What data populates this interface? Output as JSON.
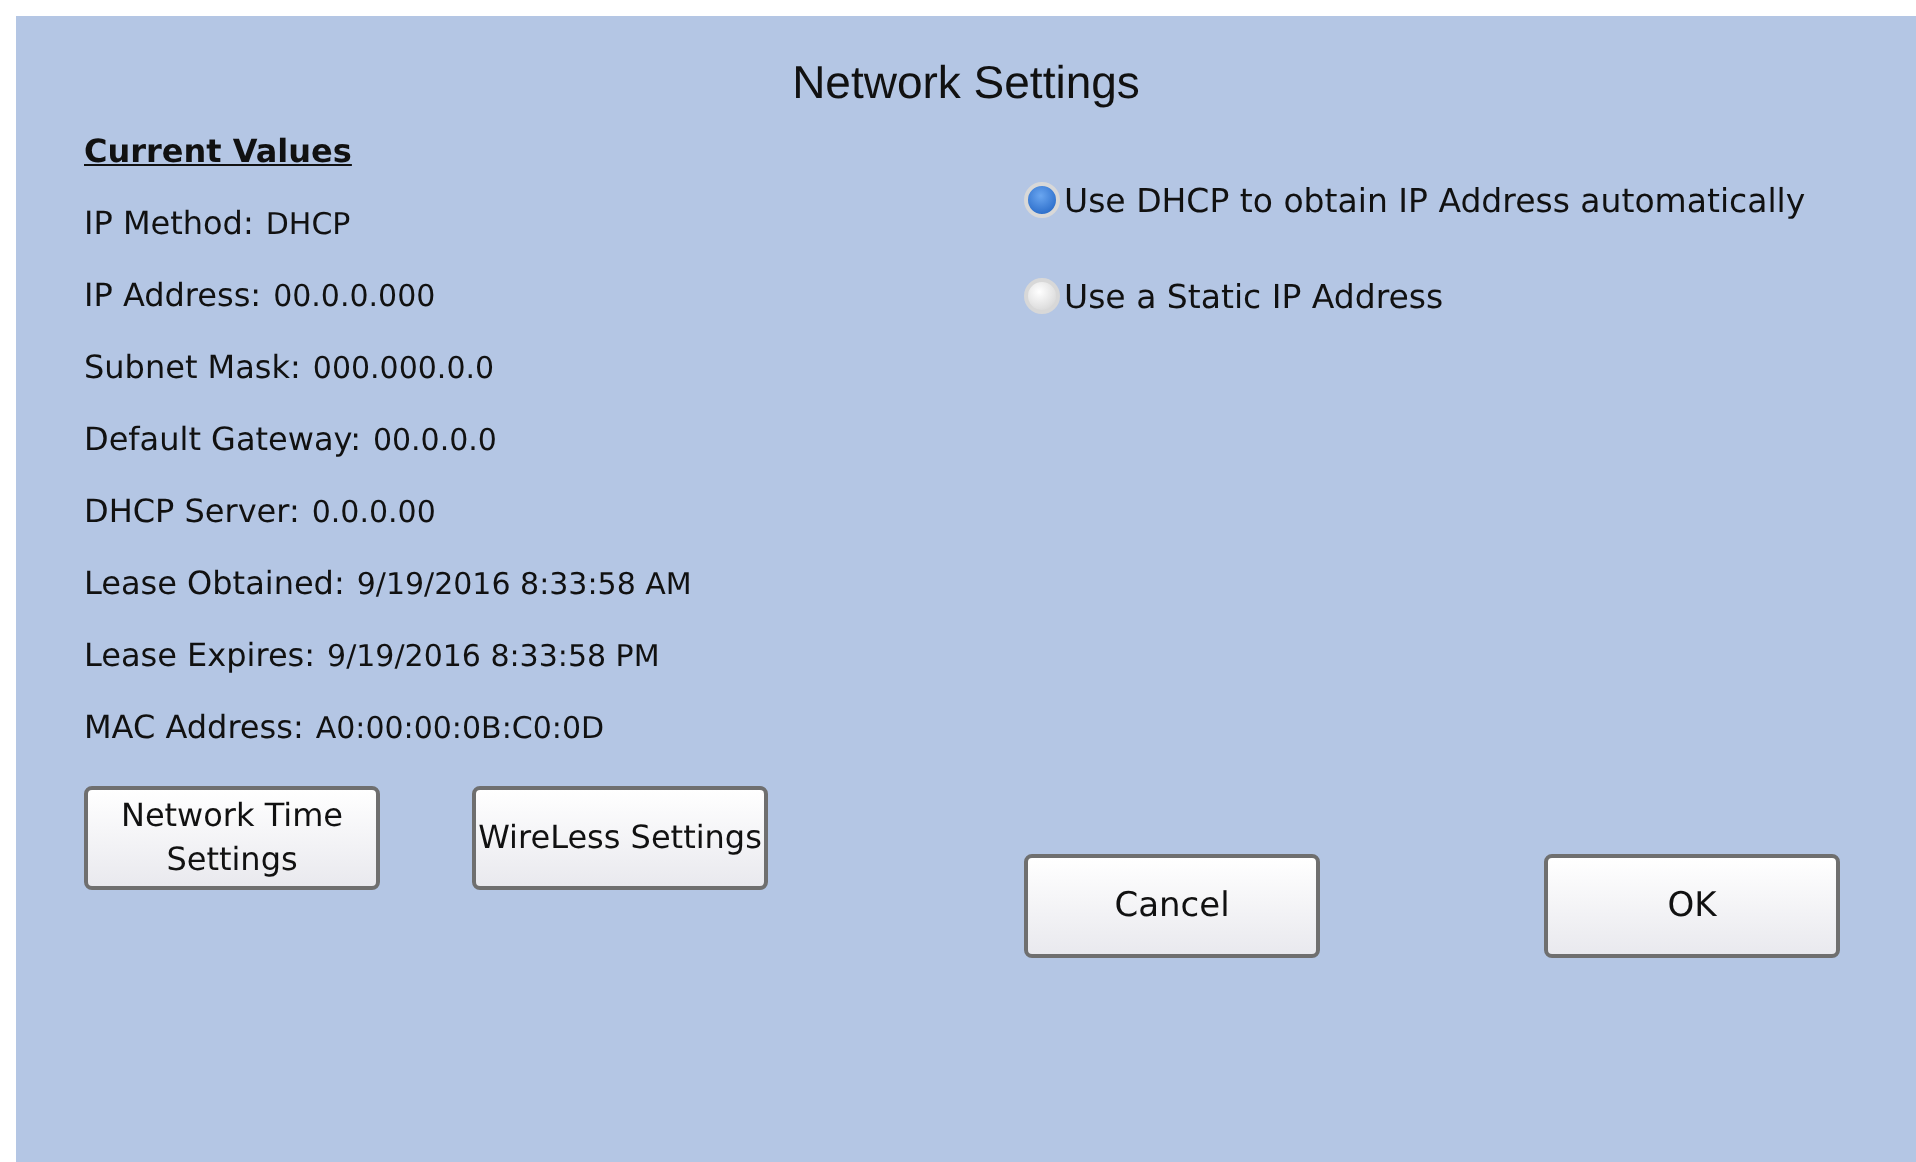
{
  "title": "Network Settings",
  "current_values": {
    "heading": "Current Values",
    "rows": [
      {
        "label": "IP Method:",
        "value": "DHCP"
      },
      {
        "label": "IP Address:",
        "value": "00.0.0.000"
      },
      {
        "label": "Subnet Mask:",
        "value": "000.000.0.0"
      },
      {
        "label": "Default Gateway:",
        "value": "00.0.0.0"
      },
      {
        "label": "DHCP Server:",
        "value": "0.0.0.00"
      },
      {
        "label": "Lease Obtained:",
        "value": "9/19/2016 8:33:58 AM"
      },
      {
        "label": "Lease Expires:",
        "value": "9/19/2016 8:33:58 PM"
      },
      {
        "label": "MAC Address:",
        "value": "A0:00:00:0B:C0:0D"
      }
    ]
  },
  "ip_options": [
    {
      "label": "Use DHCP to obtain IP Address automatically",
      "selected": true
    },
    {
      "label": "Use a Static IP Address",
      "selected": false
    }
  ],
  "settings_buttons": [
    "Network Time Settings",
    "WireLess Settings"
  ],
  "dialog_buttons": [
    "Cancel",
    "OK"
  ]
}
